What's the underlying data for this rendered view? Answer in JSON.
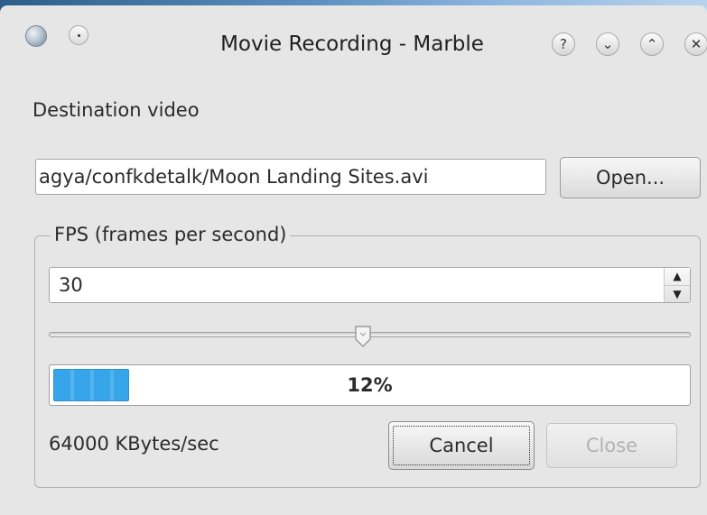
{
  "window": {
    "title": "Movie Recording - Marble",
    "buttons": {
      "help_glyph": "?",
      "minimize_glyph": "⌄",
      "maximize_glyph": "⌃",
      "close_glyph": "✕"
    }
  },
  "destination": {
    "label": "Destination video",
    "path_value": "agya/confkdetalk/Moon Landing Sites.avi",
    "open_label": "Open..."
  },
  "fps": {
    "group_label": "FPS (frames per second)",
    "value": "30",
    "slider_fraction": 0.49
  },
  "progress": {
    "percent": 12,
    "label": "12%"
  },
  "status": {
    "rate_text": "64000 KBytes/sec"
  },
  "actions": {
    "cancel_label": "Cancel",
    "close_label": "Close"
  },
  "colors": {
    "progress_fill": "#37a5ea",
    "window_bg": "#e6e6e6"
  }
}
